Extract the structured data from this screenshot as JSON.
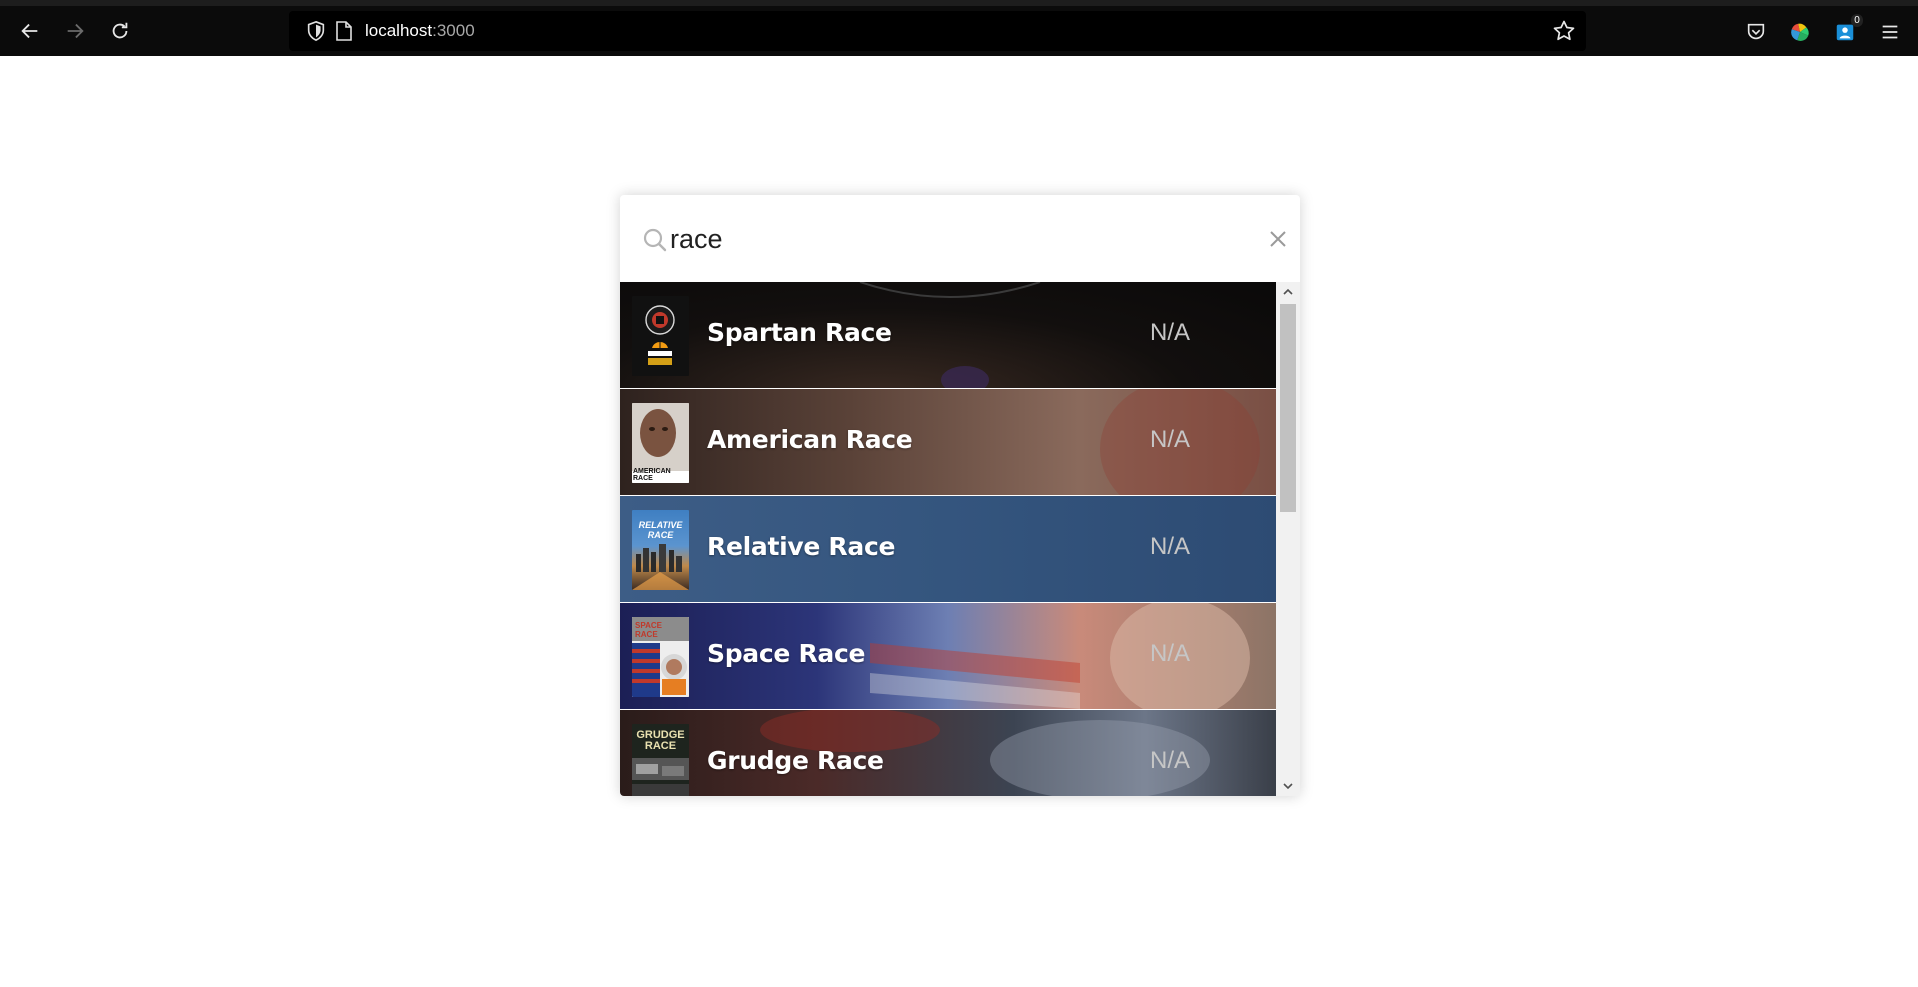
{
  "browser": {
    "url_host": "localhost",
    "url_port": ":3000",
    "extension_badge": "0"
  },
  "search": {
    "value": "race",
    "placeholder": ""
  },
  "results": [
    {
      "title": "Spartan Race",
      "rating": "N/A"
    },
    {
      "title": "American Race",
      "rating": "N/A"
    },
    {
      "title": "Relative Race",
      "rating": "N/A"
    },
    {
      "title": "Space Race",
      "rating": "N/A"
    },
    {
      "title": "Grudge Race",
      "rating": "N/A"
    }
  ],
  "thumbnails": {
    "american": "AMERICAN RACE",
    "relative": "RELATIVE RACE",
    "grudge": "GRUDGE RACE",
    "space": "SPACE RACE"
  },
  "colors": {
    "chrome_bg": "#0b0b0b",
    "urlbar_bg": "#000000",
    "spartan_bg": "#141210",
    "american_bg": "#5e463d",
    "relative_bg": "#35557d",
    "space_bg": "#2b2f6b",
    "grudge_bg": "#2c2f35"
  }
}
